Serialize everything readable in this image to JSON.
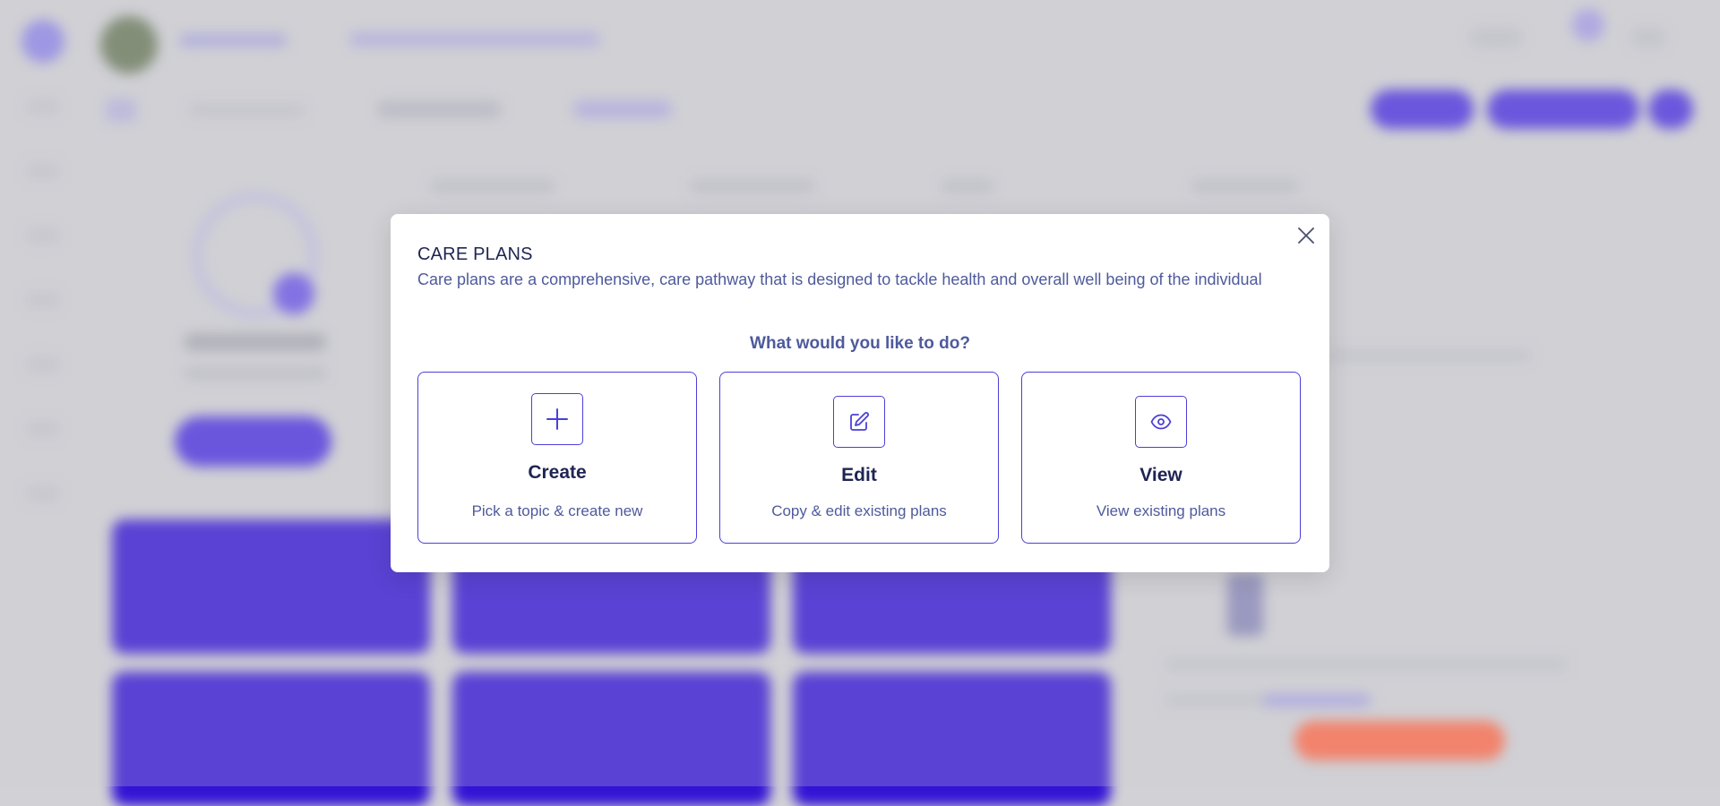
{
  "modal": {
    "title": "CARE PLANS",
    "description": "Care plans are a comprehensive, care pathway that is designed to tackle health and overall well being of the individual",
    "prompt": "What would you like to do?",
    "options": [
      {
        "title": "Create",
        "subtitle": "Pick a topic & create new",
        "icon": "plus-icon"
      },
      {
        "title": "Edit",
        "subtitle": "Copy & edit existing plans",
        "icon": "pencil-square-icon"
      },
      {
        "title": "View",
        "subtitle": "View existing plans",
        "icon": "eye-icon"
      }
    ],
    "close_icon": "close-icon"
  },
  "colors": {
    "accent": "#4b3fd9",
    "heading": "#1f2552",
    "body_text": "#4e5a9c",
    "background_card": "#3414d4",
    "background_orange": "#ff6b4a"
  }
}
